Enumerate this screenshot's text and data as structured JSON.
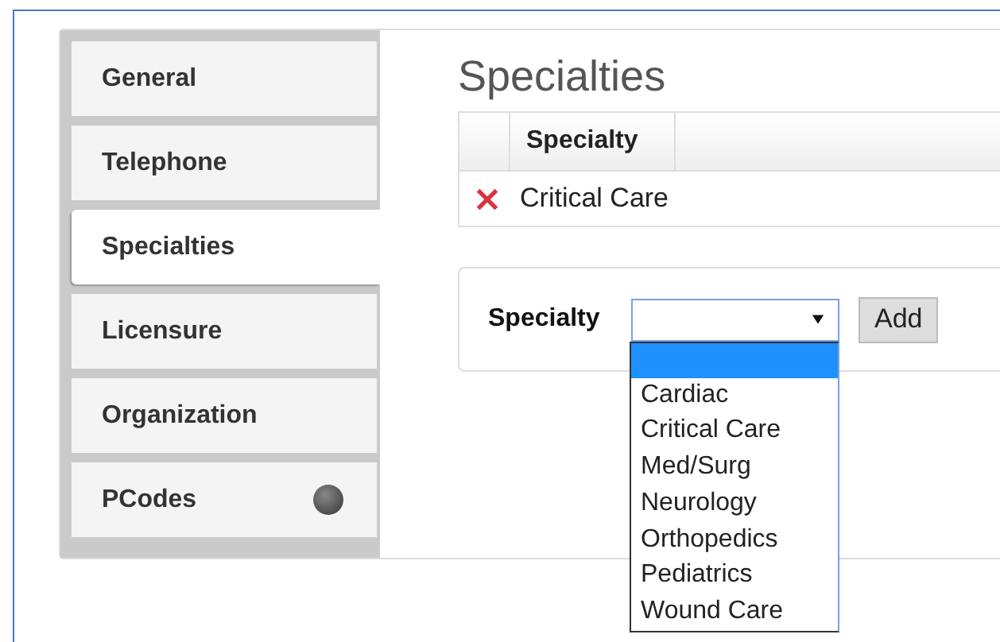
{
  "sidebar": {
    "items": [
      {
        "label": "General",
        "selected": false,
        "indicator": false
      },
      {
        "label": "Telephone",
        "selected": false,
        "indicator": false
      },
      {
        "label": "Specialties",
        "selected": true,
        "indicator": false
      },
      {
        "label": "Licensure",
        "selected": false,
        "indicator": false
      },
      {
        "label": "Organization",
        "selected": false,
        "indicator": false
      },
      {
        "label": "PCodes",
        "selected": false,
        "indicator": true
      }
    ]
  },
  "title": "Specialties",
  "table": {
    "columns": [
      "Specialty"
    ],
    "rows": [
      {
        "specialty": "Critical Care"
      }
    ]
  },
  "form": {
    "label": "Specialty",
    "select": {
      "open": true,
      "blank_option": {
        "selected": true
      },
      "options": [
        {
          "label": "Cardiac",
          "selected": false
        },
        {
          "label": "Critical Care",
          "selected": false
        },
        {
          "label": "Med/Surg",
          "selected": false
        },
        {
          "label": "Neurology",
          "selected": false
        },
        {
          "label": "Orthopedics",
          "selected": false
        },
        {
          "label": "Pediatrics",
          "selected": false
        },
        {
          "label": "Wound Care",
          "selected": false
        }
      ]
    },
    "button": "Add"
  }
}
